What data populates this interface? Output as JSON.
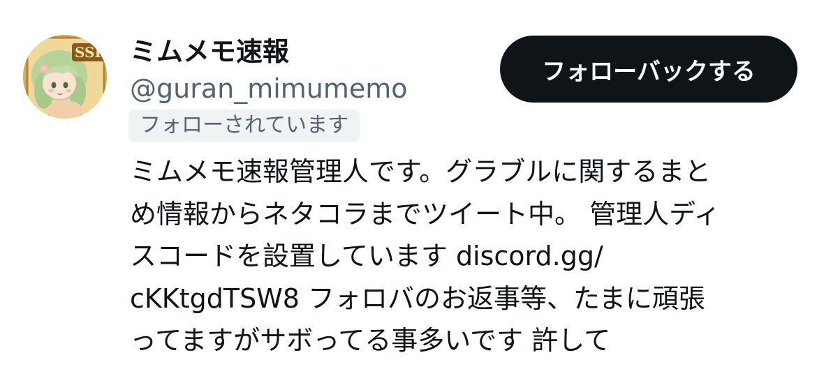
{
  "profile": {
    "display_name": "ミムメモ速報",
    "handle": "@guran_mimumemo",
    "follows_you_label": "フォローされています",
    "follow_back_label": "フォローバックする",
    "avatar_badge": "SSR",
    "bio_lines": [
      "ミムメモ速報管理人です。グラブルに関するまと",
      "め情報からネタコラまでツイート中。 管理人ディ",
      "スコードを設置しています discord.gg/",
      "cKKtgdTSW8 フォロバのお返事等、たまに頑張",
      "ってますがサボってる事多いです 許して"
    ]
  },
  "colors": {
    "button_bg": "#0f1419",
    "button_text": "#ffffff",
    "primary_text": "#0f1419",
    "secondary_text": "#536471",
    "badge_bg": "#eff3f4"
  },
  "icons": {
    "avatar": "anime-character-avatar"
  }
}
